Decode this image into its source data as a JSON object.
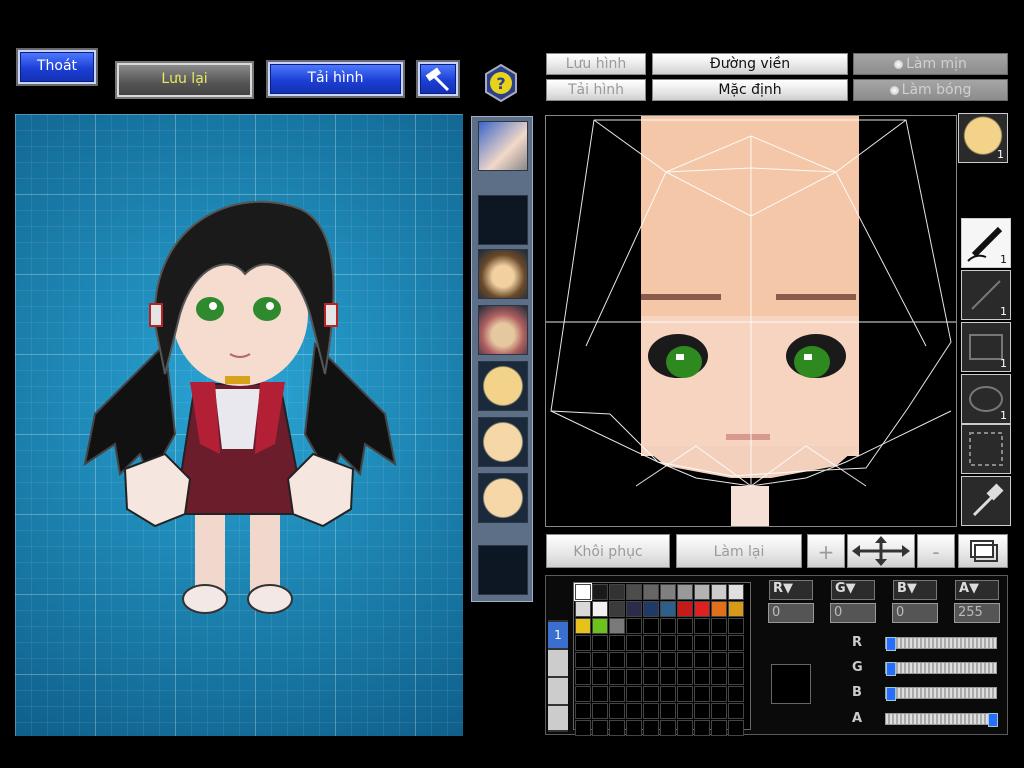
{
  "toolbar": {
    "exit_label": "Thoát",
    "save_label": "Lưu lại",
    "load_label": "Tải hình"
  },
  "editor_options": {
    "save_image_label": "Lưu hình",
    "load_image_label": "Tải hình",
    "outline_label": "Đường viền",
    "default_label": "Mặc định",
    "smooth_label": "Làm mịn",
    "shading_label": "Làm bóng"
  },
  "tools": {
    "pen_count": "1",
    "line_count": "1",
    "rect_count": "1",
    "ellipse_count": "1",
    "preview_count": "1"
  },
  "actions": {
    "restore_label": "Khôi phục",
    "redo_label": "Làm lại",
    "zoom_in_label": "+",
    "zoom_out_label": "-"
  },
  "color": {
    "r_value": "0",
    "g_value": "0",
    "b_value": "0",
    "a_value": "255",
    "r_fraction": 0,
    "g_fraction": 0,
    "b_fraction": 0,
    "a_fraction": 1,
    "layer_tab": "1",
    "palette": [
      "#ffffff",
      "#1a1a1a",
      "#333333",
      "#4d4d4d",
      "#666666",
      "#808080",
      "#999999",
      "#b3b3b3",
      "#cccccc",
      "#e0e0e0",
      "#d9d9d9",
      "#f2f2f2",
      "#3b3b3b",
      "#2b2b4a",
      "#1f3a66",
      "#2c5f8a",
      "#c41a1a",
      "#e02020",
      "#e0701a",
      "#d69a1a",
      "#e6c21a",
      "#6bc21a",
      "#7a7a7a"
    ]
  }
}
